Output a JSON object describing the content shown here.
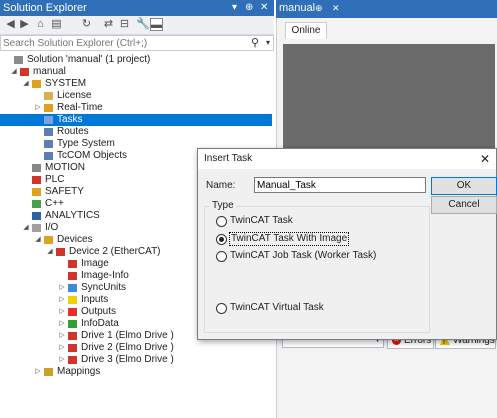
{
  "solution_explorer": {
    "title": "Solution Explorer",
    "title_controls": [
      "▾",
      "⊕",
      "✕"
    ],
    "search_placeholder": "Search Solution Explorer (Ctrl+;)",
    "tree": [
      {
        "label": "Solution 'manual' (1 project)",
        "icon": "solution-icon",
        "expander": ""
      },
      {
        "label": "manual",
        "icon": "project-icon",
        "expander": "◢"
      },
      {
        "label": "SYSTEM",
        "icon": "system-icon",
        "expander": "◢"
      },
      {
        "label": "License",
        "icon": "license-icon",
        "expander": ""
      },
      {
        "label": "Real-Time",
        "icon": "realtime-icon",
        "expander": "▷"
      },
      {
        "label": "Tasks",
        "icon": "tasks-icon",
        "expander": "",
        "selected": true
      },
      {
        "label": "Routes",
        "icon": "routes-icon",
        "expander": ""
      },
      {
        "label": "Type System",
        "icon": "type-system-icon",
        "expander": ""
      },
      {
        "label": "TcCOM Objects",
        "icon": "tccom-icon",
        "expander": ""
      },
      {
        "label": "MOTION",
        "icon": "motion-icon",
        "expander": ""
      },
      {
        "label": "PLC",
        "icon": "plc-icon",
        "expander": ""
      },
      {
        "label": "SAFETY",
        "icon": "safety-icon",
        "expander": ""
      },
      {
        "label": "C++",
        "icon": "cpp-icon",
        "expander": ""
      },
      {
        "label": "ANALYTICS",
        "icon": "analytics-icon",
        "expander": ""
      },
      {
        "label": "I/O",
        "icon": "io-icon",
        "expander": "◢"
      },
      {
        "label": "Devices",
        "icon": "devices-icon",
        "expander": "◢"
      },
      {
        "label": "Device 2 (EtherCAT)",
        "icon": "ethercat-icon",
        "expander": "◢"
      },
      {
        "label": "Image",
        "icon": "image-icon",
        "expander": ""
      },
      {
        "label": "Image-Info",
        "icon": "image-info-icon",
        "expander": ""
      },
      {
        "label": "SyncUnits",
        "icon": "syncunits-icon",
        "expander": "▷"
      },
      {
        "label": "Inputs",
        "icon": "inputs-icon",
        "expander": "▷"
      },
      {
        "label": "Outputs",
        "icon": "outputs-icon",
        "expander": "▷"
      },
      {
        "label": "InfoData",
        "icon": "infodata-icon",
        "expander": "▷"
      },
      {
        "label": "Drive 1 (Elmo Drive )",
        "icon": "drive-icon",
        "expander": "▷"
      },
      {
        "label": "Drive 2 (Elmo Drive )",
        "icon": "drive-icon",
        "expander": "▷"
      },
      {
        "label": "Drive 3 (Elmo Drive )",
        "icon": "drive-icon",
        "expander": "▷"
      },
      {
        "label": "Mappings",
        "icon": "mappings-icon",
        "expander": "▷"
      }
    ]
  },
  "document": {
    "tab_label": "manual",
    "tab_pin": "⊕",
    "tab_close": "✕",
    "inner_tab": "Online",
    "errors_label": "Errors",
    "warnings_label": "Warnings"
  },
  "dialog": {
    "title": "Insert Task",
    "close": "✕",
    "name_label": "Name:",
    "name_value": "Manual_Task",
    "ok_label": "OK",
    "cancel_label": "Cancel",
    "type_group_label": "Type",
    "options": [
      {
        "label": "TwinCAT Task",
        "checked": false
      },
      {
        "label": "TwinCAT Task With Image",
        "checked": true
      },
      {
        "label": "TwinCAT Job Task (Worker Task)",
        "checked": false
      },
      {
        "label": "TwinCAT Virtual Task",
        "checked": false
      }
    ]
  },
  "colors": {
    "title_bar": "#2f6fb7",
    "selection": "#0078d7",
    "error": "#e51400",
    "warning": "#f2c200"
  }
}
